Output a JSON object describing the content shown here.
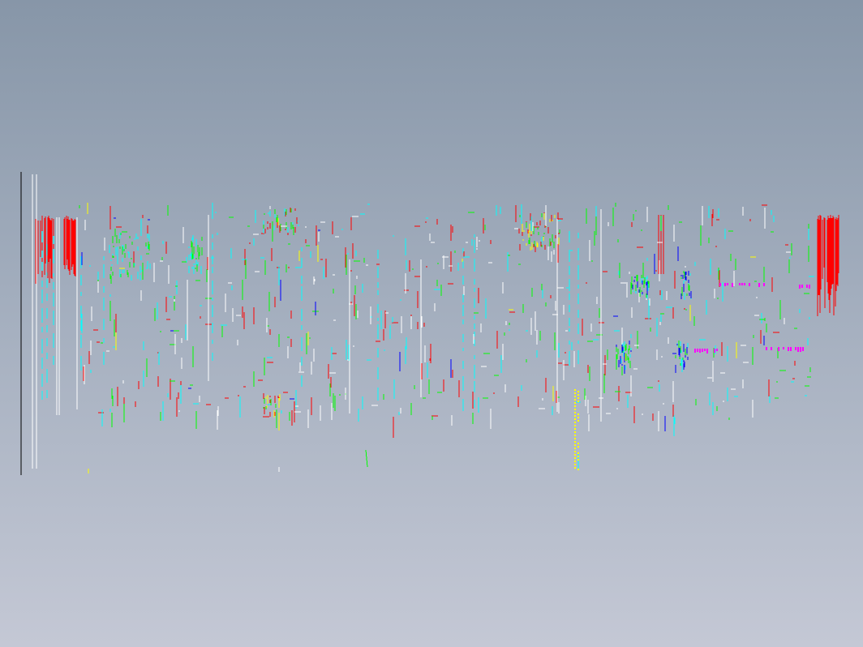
{
  "viewport": {
    "background_top": "#8796a8",
    "background_bottom": "#c4c8d5"
  },
  "drawing": {
    "description_visible_text": "",
    "palette": {
      "red": "#ff0000",
      "cyan": "#00ffff",
      "green": "#00ff00",
      "yellow": "#ffff00",
      "blue": "#0000ff",
      "magenta": "#ff00ff",
      "white": "#ffffff",
      "black": "#000000"
    }
  }
}
